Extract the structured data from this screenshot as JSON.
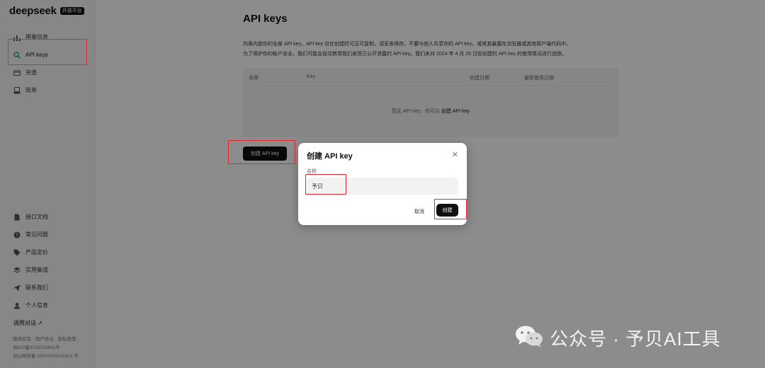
{
  "brand": {
    "name": "deepseek",
    "badge": "开放平台"
  },
  "sidebar": {
    "top_items": [
      {
        "label": "用量信息",
        "icon": "bar-chart-icon"
      },
      {
        "label": "API keys",
        "icon": "search-icon"
      },
      {
        "label": "充值",
        "icon": "wallet-icon"
      },
      {
        "label": "账单",
        "icon": "bill-icon"
      }
    ],
    "bottom_items": [
      {
        "label": "接口文档",
        "icon": "doc-icon"
      },
      {
        "label": "常见问题",
        "icon": "question-icon"
      },
      {
        "label": "产品定价",
        "icon": "tag-icon"
      },
      {
        "label": "实用集成",
        "icon": "layers-icon"
      },
      {
        "label": "联系我们",
        "icon": "send-icon"
      },
      {
        "label": "个人信息",
        "icon": "user-icon"
      }
    ],
    "api_chat": "调用对话 ↗",
    "footer": [
      "服务状态 · 用户协议 · 隐私政策 ·",
      "浙ICP备2023025841号 ·",
      "浙公网安备 33010502011812 号"
    ]
  },
  "main": {
    "title": "API keys",
    "desc_line1": "列表内是你的全部 API key，API key 仅在创建时可见可复制，请妥善保存。不要与他人共享你的 API key，或将其暴露在浏览器或其他客户端代码中。",
    "desc_line2": "为了保护你的帐户安全，我们可能会自动禁用我们发现已公开泄露的 API key。我们未对 2024 年 4 月 25 日前创建的 API key 的使用情况进行追踪。",
    "table": {
      "headers": [
        "名称",
        "Key",
        "创建日期",
        "最新使用日期"
      ],
      "empty_text": "暂无 API key，你可以",
      "empty_link": "创建 API key"
    },
    "create_button": "创建 API key"
  },
  "modal": {
    "title": "创建 API key",
    "close_icon": "close-icon",
    "field_label": "名称",
    "field_value": "予贝",
    "cancel": "取消",
    "create": "创建"
  },
  "watermark": {
    "text": "公众号 · 予贝AI工具",
    "icon": "wechat-icon"
  },
  "colors": {
    "highlight": "#e3262a",
    "active_icon": "#2aa15a",
    "primary_button": "#111111"
  }
}
